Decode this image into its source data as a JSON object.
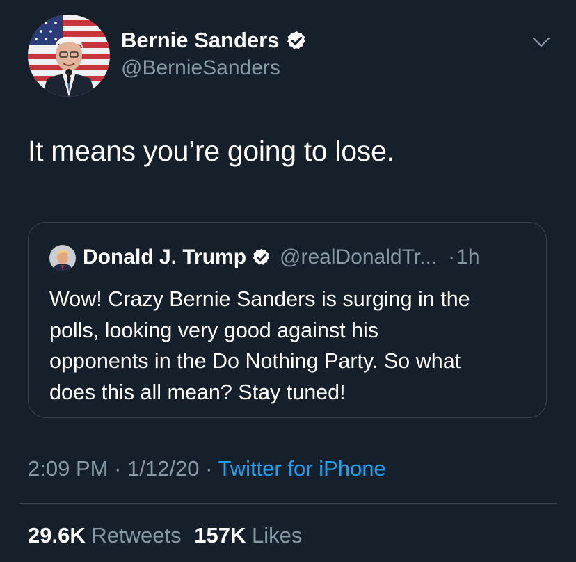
{
  "author": {
    "display_name": "Bernie Sanders",
    "handle": "@BernieSanders",
    "avatar_icon": "profile-photo-flag-background",
    "verified_icon": "verified-badge-icon"
  },
  "tweet": {
    "text": "It means you’re going to lose."
  },
  "quoted_tweet": {
    "display_name": "Donald J. Trump",
    "handle": "@realDonaldTr...",
    "separator": "·",
    "time": "1h",
    "lines": [
      "Wow! Crazy Bernie Sanders is surging in the",
      "polls, looking very good against his",
      "opponents in the Do Nothing Party. So what",
      "does this all mean? Stay tuned!"
    ]
  },
  "meta": {
    "time": "2:09 PM",
    "sep1": " · ",
    "date": "1/12/20",
    "sep2": " · ",
    "source": "Twitter for iPhone"
  },
  "stats": {
    "retweets_count": "29.6K",
    "retweets_label": "Retweets",
    "likes_count": "157K",
    "likes_label": "Likes"
  },
  "colors": {
    "background": "#15202b",
    "text_primary": "#ffffff",
    "text_secondary": "#8899a6",
    "accent": "#1da1f2",
    "border": "#38444d"
  }
}
